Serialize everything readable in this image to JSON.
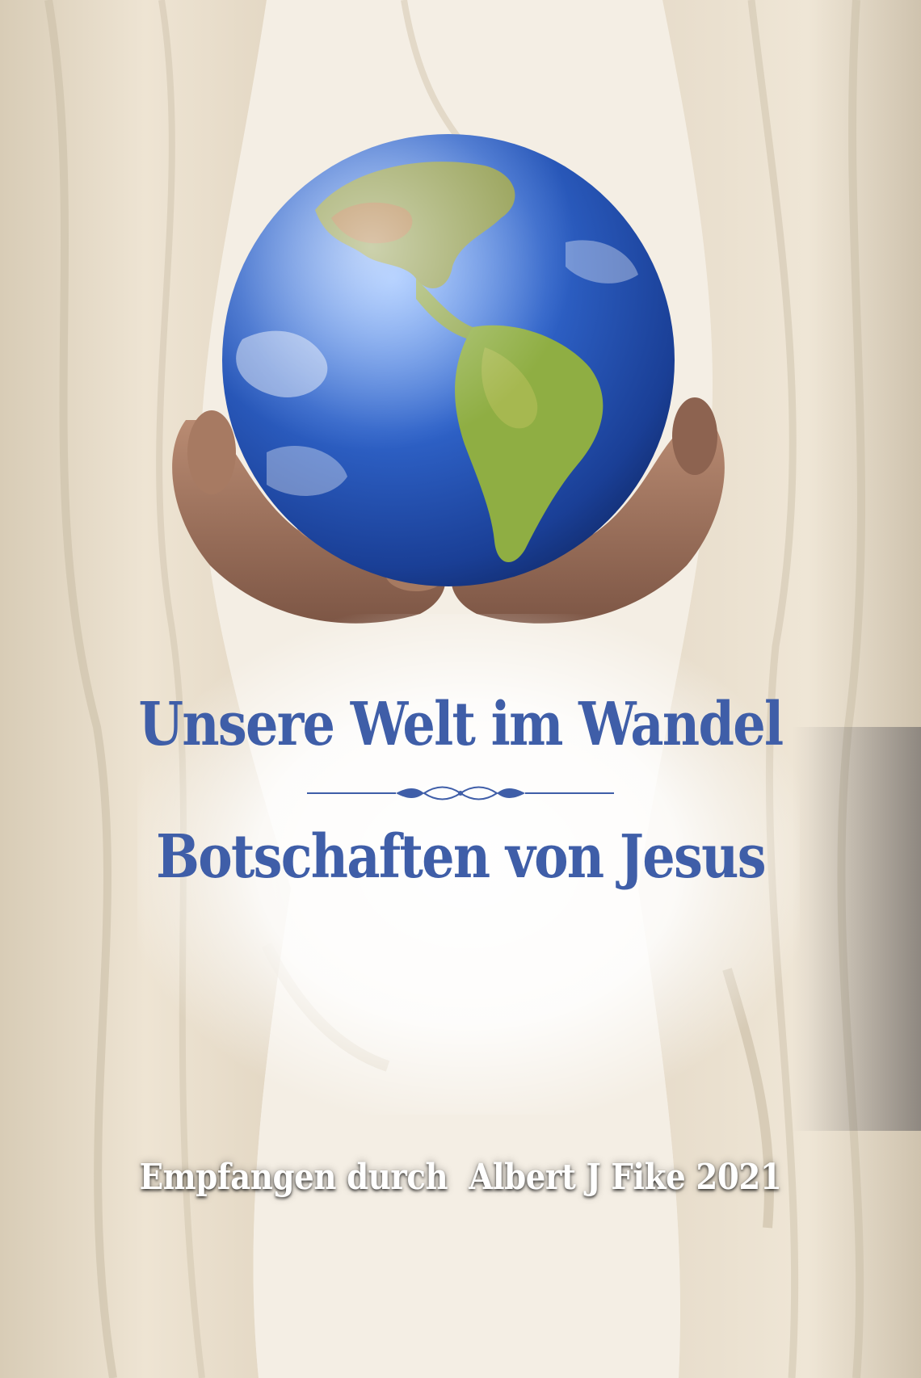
{
  "cover": {
    "title_line_1": "Unsere Welt im Wandel",
    "title_line_2": "Botschaften von Jesus",
    "author_line": "Empfangen durch  Albert J Fike 2021"
  },
  "colors": {
    "title": "#3f5ea8",
    "author": "#ffffff",
    "robe": "#ede3d2",
    "ocean": "#2f63c9",
    "land": "#8fae43",
    "skin": "#a0735c"
  },
  "icons": {
    "divider": "ornamental-divider",
    "globe": "earth-globe",
    "hands": "cupped-hands"
  }
}
